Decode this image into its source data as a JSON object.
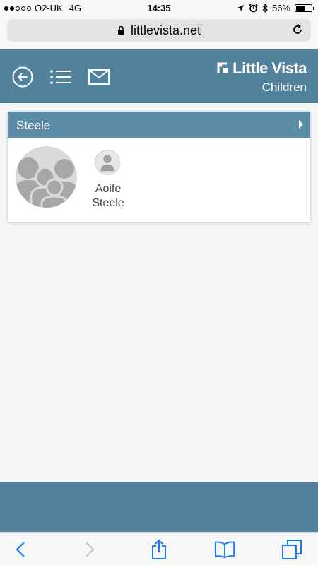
{
  "status_bar": {
    "carrier": "O2-UK",
    "network": "4G",
    "time": "14:35",
    "battery": "56%",
    "battery_level": 0.56
  },
  "browser": {
    "url": "littlevista.net"
  },
  "header": {
    "brand_name": "Little Vista",
    "brand_sub": "Children",
    "icons": [
      "back-circle-icon",
      "list-icon",
      "mail-icon"
    ]
  },
  "family": {
    "name": "Steele",
    "children": [
      {
        "first": "Aoife",
        "last": "Steele"
      }
    ]
  },
  "colors": {
    "header": "#52829b",
    "card_header": "#5b8ca8",
    "ios_blue": "#1a7cf4"
  }
}
